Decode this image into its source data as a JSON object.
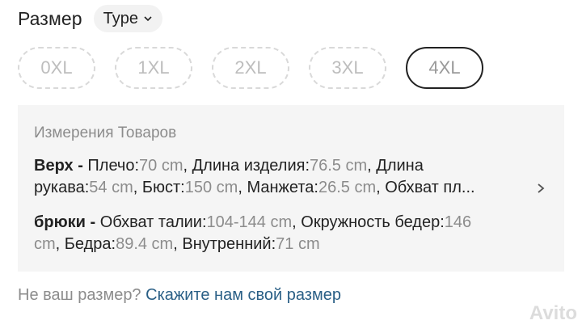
{
  "header": {
    "title": "Размер",
    "type_label": "Type"
  },
  "sizes": [
    {
      "label": "0XL",
      "selected": false
    },
    {
      "label": "1XL",
      "selected": false
    },
    {
      "label": "2XL",
      "selected": false
    },
    {
      "label": "3XL",
      "selected": false
    },
    {
      "label": "4XL",
      "selected": true
    }
  ],
  "measurements": {
    "title": "Измерения Товаров",
    "top": {
      "label": "Верх -",
      "line1": [
        {
          "k": "Плечо:",
          "v": "70 cm"
        },
        {
          "k": "Длина изделия:",
          "v": "76.5 cm"
        },
        {
          "k": "Длина",
          "v": ""
        }
      ],
      "line2": [
        {
          "k": "рукава:",
          "v": "54 cm"
        },
        {
          "k": "Бюст:",
          "v": "150 cm"
        },
        {
          "k": "Манжета:",
          "v": "26.5 cm"
        },
        {
          "k": "Обхват пл...",
          "v": ""
        }
      ]
    },
    "pants": {
      "label": "брюки -",
      "line1": [
        {
          "k": "Обхват талии:",
          "v": "104-144 cm"
        },
        {
          "k": "Окружность бедер:",
          "v": "146"
        }
      ],
      "line2": [
        {
          "k": "",
          "v": "cm"
        },
        {
          "k": "Бедра:",
          "v": "89.4 cm"
        },
        {
          "k": "Внутренний:",
          "v": "71 cm"
        }
      ]
    }
  },
  "footer": {
    "question": "Не ваш размер?",
    "link": "Скажите нам свой размер"
  },
  "watermark": "Avito"
}
